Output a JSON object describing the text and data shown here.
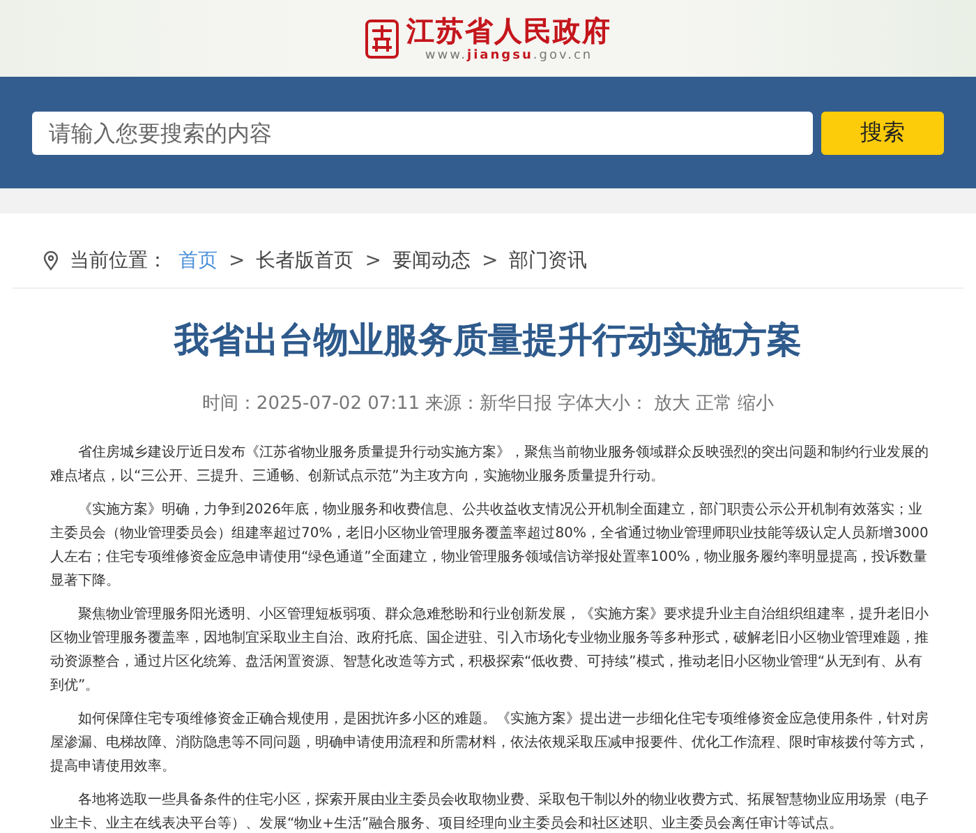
{
  "header": {
    "site_name": "江苏省人民政府",
    "url_prefix": "www.",
    "url_domain": "jiangsu",
    "url_suffix": ".gov.cn"
  },
  "search": {
    "placeholder": "请输入您要搜索的内容",
    "button": "搜索"
  },
  "breadcrumb": {
    "label": "当前位置：",
    "items": [
      {
        "text": "首页",
        "kind": "link"
      },
      {
        "text": "长者版首页",
        "kind": "plain"
      },
      {
        "text": "要闻动态",
        "kind": "plain"
      },
      {
        "text": "部门资讯",
        "kind": "plain"
      }
    ],
    "separator": ">"
  },
  "article": {
    "title": "我省出台物业服务质量提升行动实施方案",
    "meta": {
      "time_label": "时间：",
      "time": "2025-07-02 07:11",
      "source_label": "来源：",
      "source": "新华日报",
      "font_label": "字体大小：",
      "font_options": [
        "放大",
        "正常",
        "缩小"
      ]
    },
    "paragraphs": [
      "省住房城乡建设厅近日发布《江苏省物业服务质量提升行动实施方案》，聚焦当前物业服务领域群众反映强烈的突出问题和制约行业发展的难点堵点，以“三公开、三提升、三通畅、创新试点示范”为主攻方向，实施物业服务质量提升行动。",
      "《实施方案》明确，力争到2026年底，物业服务和收费信息、公共收益收支情况公开机制全面建立，部门职责公示公开机制有效落实；业主委员会（物业管理委员会）组建率超过70%，老旧小区物业管理服务覆盖率超过80%，全省通过物业管理师职业技能等级认定人员新增3000人左右；住宅专项维修资金应急申请使用“绿色通道”全面建立，物业管理服务领域信访举报处置率100%，物业服务履约率明显提高，投诉数量显著下降。",
      "聚焦物业管理服务阳光透明、小区管理短板弱项、群众急难愁盼和行业创新发展，《实施方案》要求提升业主自治组织组建率，提升老旧小区物业管理服务覆盖率，因地制宜采取业主自治、政府托底、国企进驻、引入市场化专业物业服务等多种形式，破解老旧小区物业管理难题，推动资源整合，通过片区化统筹、盘活闲置资源、智慧化改造等方式，积极探索“低收费、可持续”模式，推动老旧小区物业管理“从无到有、从有到优”。",
      "如何保障住宅专项维修资金正确合规使用，是困扰许多小区的难题。《实施方案》提出进一步细化住宅专项维修资金应急使用条件，针对房屋渗漏、电梯故障、消防隐患等不同问题，明确申请使用流程和所需材料，依法依规采取压减申报要件、优化工作流程、限时审核拨付等方式，提高申请使用效率。",
      "各地将选取一些具备条件的住宅小区，探索开展由业主委员会收取物业费、采取包干制以外的物业收费方式、拓展智慧物业应用场景（电子业主卡、业主在线表决平台等）、发展“物业+生活”融合服务、项目经理向业主委员会和社区述职、业主委员会离任审计等试点。"
    ]
  }
}
